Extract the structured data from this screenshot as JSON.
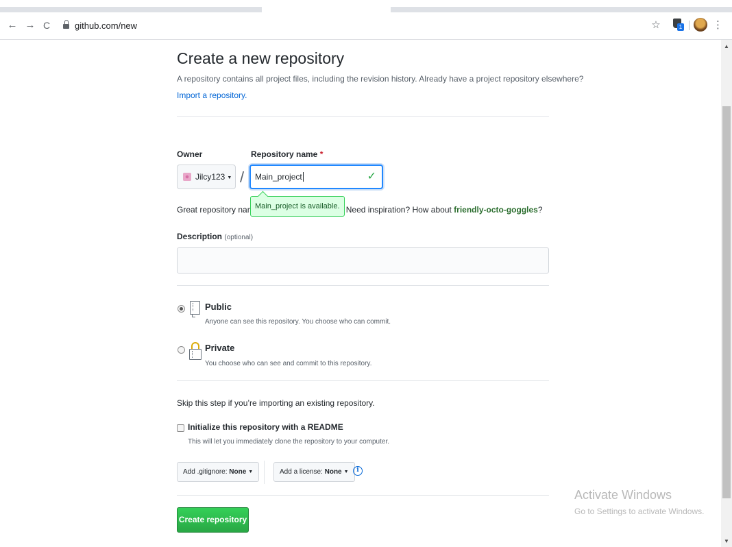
{
  "browser": {
    "url": "github.com/new",
    "back_glyph": "←",
    "forward_glyph": "→",
    "reload_glyph": "C",
    "star_glyph": "☆",
    "menu_glyph": "⋮",
    "extension_badge": "1"
  },
  "page": {
    "title": "Create a new repository",
    "subtitle": "A repository contains all project files, including the revision history. Already have a project repository elsewhere?",
    "import_link": "Import a repository."
  },
  "form": {
    "owner_label": "Owner",
    "owner_value": "Jilcy123",
    "slash": "/",
    "repo_label": "Repository name",
    "required_mark": "*",
    "repo_value": "Main_project",
    "check_glyph": "✓",
    "availability_tooltip": "Main_project is available.",
    "great_prefix": "Great repository name",
    "great_mid": "e. Need inspiration? How about",
    "great_suggestion": "friendly-octo-goggles",
    "great_suffix": "?",
    "description_label": "Description",
    "description_optional": "(optional)",
    "description_value": ""
  },
  "visibility": {
    "selected": "public",
    "public_title": "Public",
    "public_desc": "Anyone can see this repository. You choose who can commit.",
    "private_title": "Private",
    "private_desc": "You choose who can see and commit to this repository."
  },
  "init": {
    "skip_text": "Skip this step if you’re importing an existing repository.",
    "readme_label": "Initialize this repository with a README",
    "readme_desc": "This will let you immediately clone the repository to your computer.",
    "readme_checked": false,
    "gitignore_prefix": "Add .gitignore:",
    "gitignore_value": "None",
    "license_prefix": "Add a license:",
    "license_value": "None",
    "info_glyph": "i"
  },
  "actions": {
    "create_label": "Create repository"
  },
  "watermark": {
    "line1": "Activate Windows",
    "line2": "Go to Settings to activate Windows."
  },
  "colors": {
    "accent_blue": "#0366d6",
    "primary_green": "#28a745",
    "tooltip_bg": "#dcffe4"
  }
}
